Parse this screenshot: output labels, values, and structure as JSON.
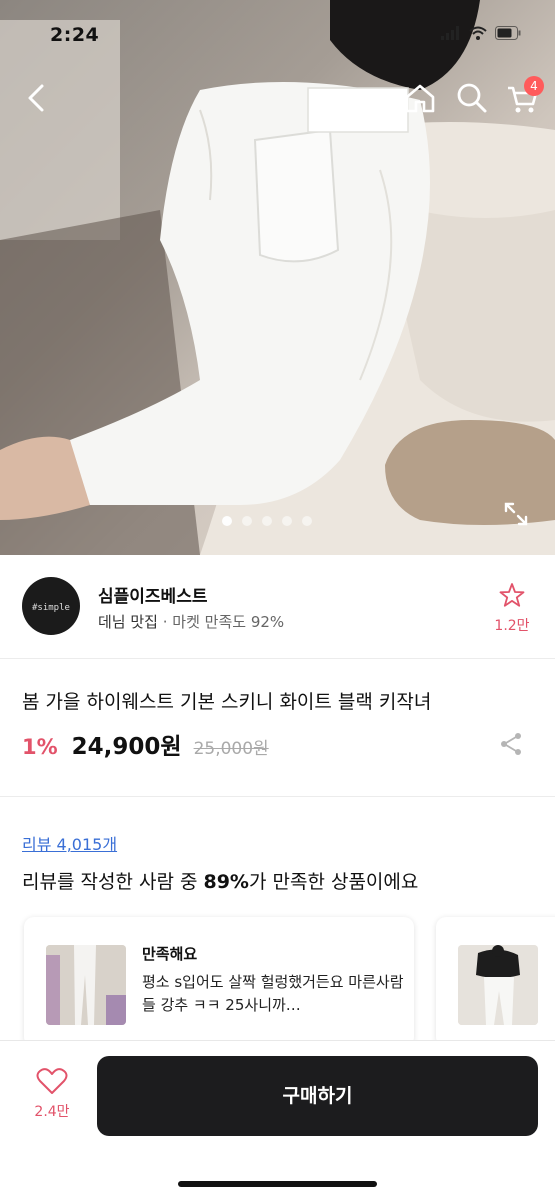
{
  "status": {
    "time": "2:24"
  },
  "nav": {
    "cart_count": "4"
  },
  "carousel": {
    "total": 5,
    "active": 0
  },
  "seller": {
    "avatar_text": "#simple",
    "name": "심플이즈베스트",
    "category": "데님 맛집",
    "satisfaction": "· 마켓 만족도 92%",
    "favorite_count": "1.2만"
  },
  "product": {
    "title": "봄 가을 하이웨스트 기본 스키니 화이트 블랙 키작녀",
    "discount": "1%",
    "price": "24,900원",
    "original_price": "25,000원"
  },
  "reviews": {
    "link": "리뷰 4,015개",
    "summary_prefix": "리뷰를 작성한 사람 중 ",
    "summary_percent": "89%",
    "summary_suffix": "가 만족한 상품이에요",
    "cards": [
      {
        "title": "만족해요",
        "text": "평소 s입어도 살짝 헐렁했거든요 마른사람들 강추 ㅋㅋ 25사니까…"
      }
    ]
  },
  "bottom": {
    "like_count": "2.4만",
    "buy_label": "구매하기"
  },
  "colors": {
    "accent": "#e2536a",
    "link": "#3a6fd6",
    "buy_button": "#1c1c1e",
    "badge": "#ff5b5b"
  }
}
